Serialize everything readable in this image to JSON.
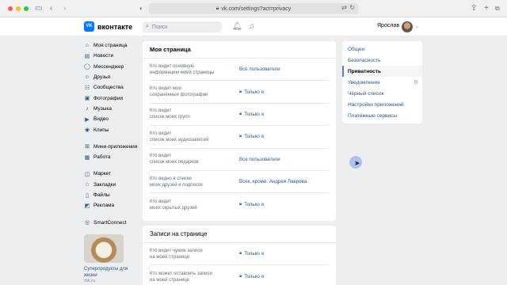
{
  "browser": {
    "url": "vk.com/settings?act=privacy",
    "back_icon": "back-arrow-icon",
    "forward_icon": "forward-arrow-icon"
  },
  "header": {
    "logo_text": "вконтакте",
    "logo_mark": "VK",
    "search_placeholder": "Поиск",
    "user_name": "Ярослав"
  },
  "sidebar": {
    "items": [
      {
        "label": "Моя страница",
        "icon": "home-icon"
      },
      {
        "label": "Новости",
        "icon": "news-icon"
      },
      {
        "label": "Мессенджер",
        "icon": "message-icon"
      },
      {
        "label": "Друзья",
        "icon": "friends-icon"
      },
      {
        "label": "Сообщества",
        "icon": "groups-icon"
      },
      {
        "label": "Фотографии",
        "icon": "photo-icon"
      },
      {
        "label": "Музыка",
        "icon": "music-icon"
      },
      {
        "label": "Видео",
        "icon": "video-icon"
      },
      {
        "label": "Клипы",
        "icon": "clips-icon"
      },
      {
        "label": "Мини-приложения",
        "icon": "apps-icon"
      },
      {
        "label": "Работа",
        "icon": "work-icon"
      },
      {
        "label": "Маркет",
        "icon": "market-icon"
      },
      {
        "label": "Закладки",
        "icon": "bookmark-icon"
      },
      {
        "label": "Файлы",
        "icon": "files-icon"
      },
      {
        "label": "Реклама",
        "icon": "ads-icon"
      },
      {
        "label": "SmartConnect",
        "icon": "smartconnect-icon"
      }
    ],
    "promo": {
      "title": "Суперпродукты для жизни",
      "source": "rbk.ru"
    }
  },
  "main": {
    "section1": {
      "title": "Моя страница",
      "rows": [
        {
          "label": "Кто видит основную\nинформацию моей страницы",
          "value": "Все пользователи",
          "locked": false
        },
        {
          "label": "Кто видит мои\nсохранённые фотографии",
          "value": "Только я",
          "locked": true
        },
        {
          "label": "Кто видит\nсписок моих групп",
          "value": "Только я",
          "locked": true
        },
        {
          "label": "Кто видит\nсписок моих аудиозаписей",
          "value": "Только я",
          "locked": true
        },
        {
          "label": "Кто видит\nсписок моих подарков",
          "value": "Все пользователи",
          "locked": false
        },
        {
          "label": "Кто видно в списке\nмоих друзей и подписок",
          "value": "Всех, кроме: Андрея Лаврова",
          "locked": false
        },
        {
          "label": "Кто видит\nмоих скрытых друзей",
          "value": "Только я",
          "locked": true
        }
      ]
    },
    "section2": {
      "title": "Записи на странице",
      "rows": [
        {
          "label": "Кто видит чужие записи\nна моей странице",
          "value": "Только я",
          "locked": true
        },
        {
          "label": "Кто может оставлять записи\nна моей странице",
          "value": "Только я",
          "locked": true
        }
      ]
    }
  },
  "right_menu": {
    "items": [
      {
        "label": "Общее",
        "active": false
      },
      {
        "label": "Безопасность",
        "active": false
      },
      {
        "label": "Приватность",
        "active": true
      },
      {
        "label": "Уведомления",
        "active": false
      },
      {
        "label": "Чёрный список",
        "active": false
      },
      {
        "label": "Настройки приложений",
        "active": false
      },
      {
        "label": "Платёжные сервисы",
        "active": false
      }
    ]
  },
  "colors": {
    "accent": "#2a5885",
    "brand": "#0077ff",
    "page_bg": "#edeef0"
  }
}
